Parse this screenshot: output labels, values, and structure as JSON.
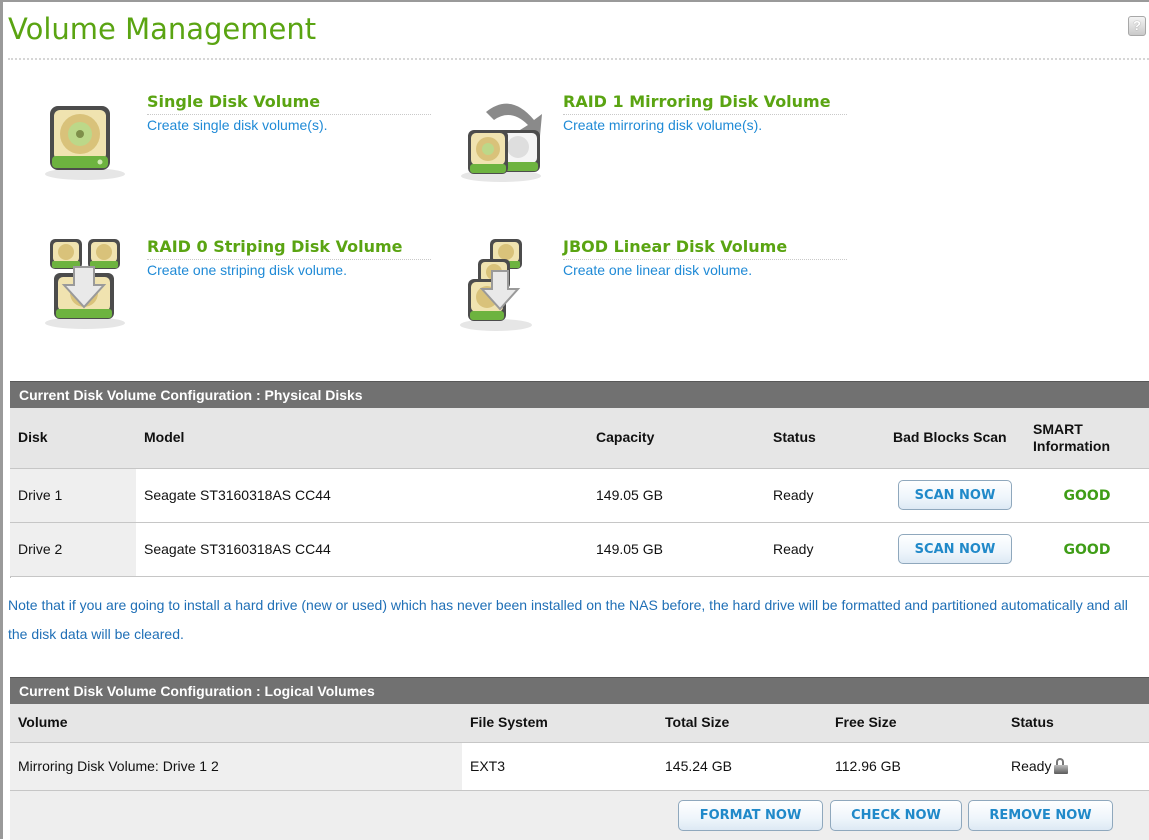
{
  "page": {
    "title": "Volume Management",
    "help_icon": "help-icon"
  },
  "options": [
    {
      "title": "Single Disk Volume",
      "desc": "Create single disk volume(s).",
      "icon": "single-disk-icon"
    },
    {
      "title": "RAID 1 Mirroring Disk Volume",
      "desc": "Create mirroring disk volume(s).",
      "icon": "mirror-disk-icon"
    },
    {
      "title": "RAID 0 Striping Disk Volume",
      "desc": "Create one striping disk volume.",
      "icon": "striping-disk-icon"
    },
    {
      "title": "JBOD Linear Disk Volume",
      "desc": "Create one linear disk volume.",
      "icon": "linear-disk-icon"
    }
  ],
  "physical": {
    "header": "Current Disk Volume Configuration : Physical Disks",
    "columns": [
      "Disk",
      "Model",
      "Capacity",
      "Status",
      "Bad Blocks Scan",
      "SMART Information"
    ],
    "rows": [
      {
        "disk": "Drive 1",
        "model": "Seagate ST3160318AS CC44",
        "capacity": "149.05 GB",
        "status": "Ready",
        "scan": "SCAN NOW",
        "smart": "GOOD"
      },
      {
        "disk": "Drive 2",
        "model": "Seagate ST3160318AS CC44",
        "capacity": "149.05 GB",
        "status": "Ready",
        "scan": "SCAN NOW",
        "smart": "GOOD"
      }
    ]
  },
  "note": "Note that if you are going to install a hard drive (new or used) which has never been installed on the NAS before, the hard drive will be formatted and partitioned automatically and all the disk data will be cleared.",
  "logical": {
    "header": "Current Disk Volume Configuration : Logical Volumes",
    "columns": [
      "Volume",
      "File System",
      "Total Size",
      "Free Size",
      "Status"
    ],
    "rows": [
      {
        "volume": "Mirroring Disk Volume: Drive 1 2",
        "fs": "EXT3",
        "total": "145.24 GB",
        "free": "112.96 GB",
        "status": "Ready",
        "status_icon": "lock-icon"
      }
    ],
    "buttons": {
      "format": "FORMAT NOW",
      "check": "CHECK NOW",
      "remove": "REMOVE NOW"
    }
  },
  "colors": {
    "accent_green": "#5aa412",
    "link_blue": "#1f8ad6",
    "header_gray": "#717171",
    "good_green": "#3f9d17"
  }
}
